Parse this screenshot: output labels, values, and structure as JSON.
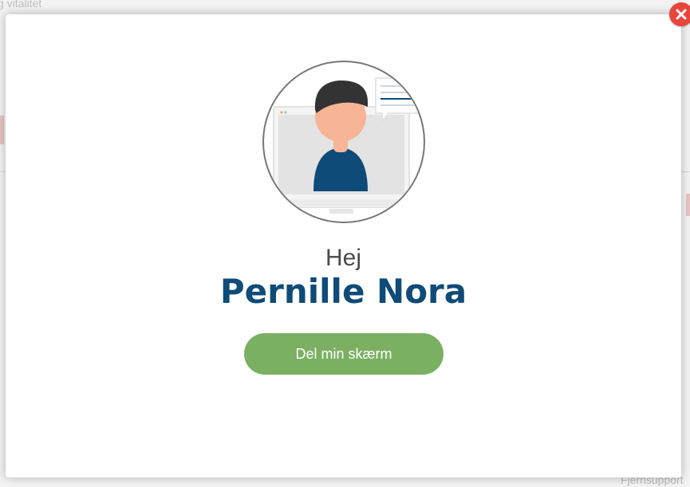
{
  "background": {
    "top_left_text": "g vitalitet",
    "bottom_right_text": "Fjernsupport"
  },
  "modal": {
    "close_icon": "close-icon",
    "avatar_icon": "user-at-screen-illustration",
    "greeting": "Hej",
    "user_name": "Pernille Nora",
    "share_button_label": "Del min skærm"
  },
  "colors": {
    "accent_green": "#7bb062",
    "name_blue": "#0f4b78",
    "close_red": "#e8453c"
  }
}
